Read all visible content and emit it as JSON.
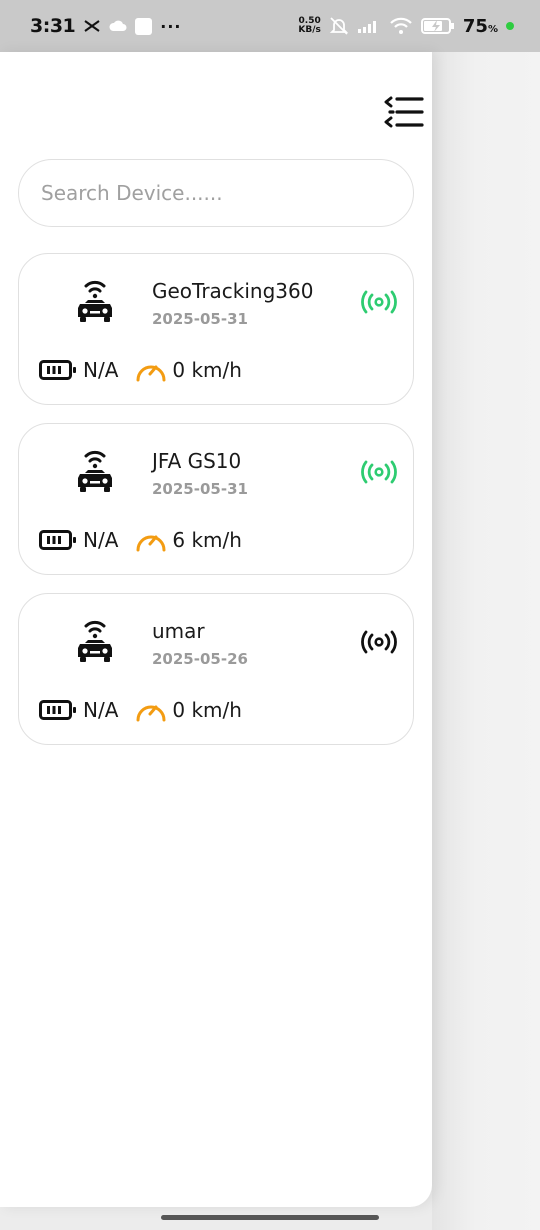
{
  "status_bar": {
    "time": "3:31",
    "net_speed_value": "0.50",
    "net_speed_unit": "KB/s",
    "battery_percent": "75",
    "battery_percent_sign": "%"
  },
  "search": {
    "placeholder": "Search Device......"
  },
  "devices": [
    {
      "name": "GeoTracking360",
      "date": "2025-05-31",
      "battery": "N/A",
      "speed": "0 km/h",
      "online": true
    },
    {
      "name": "JFA GS10",
      "date": "2025-05-31",
      "battery": "N/A",
      "speed": "6 km/h",
      "online": true
    },
    {
      "name": "umar",
      "date": "2025-05-26",
      "battery": "N/A",
      "speed": "0 km/h",
      "online": false
    }
  ],
  "colors": {
    "online": "#2ecc71",
    "offline": "#111111",
    "speed_gauge": "#f39c12"
  },
  "icons": {
    "menu": "menu-collapse-icon",
    "car": "connected-car-icon",
    "signal": "signal-broadcast-icon",
    "battery": "battery-icon",
    "speed": "speedometer-icon"
  }
}
